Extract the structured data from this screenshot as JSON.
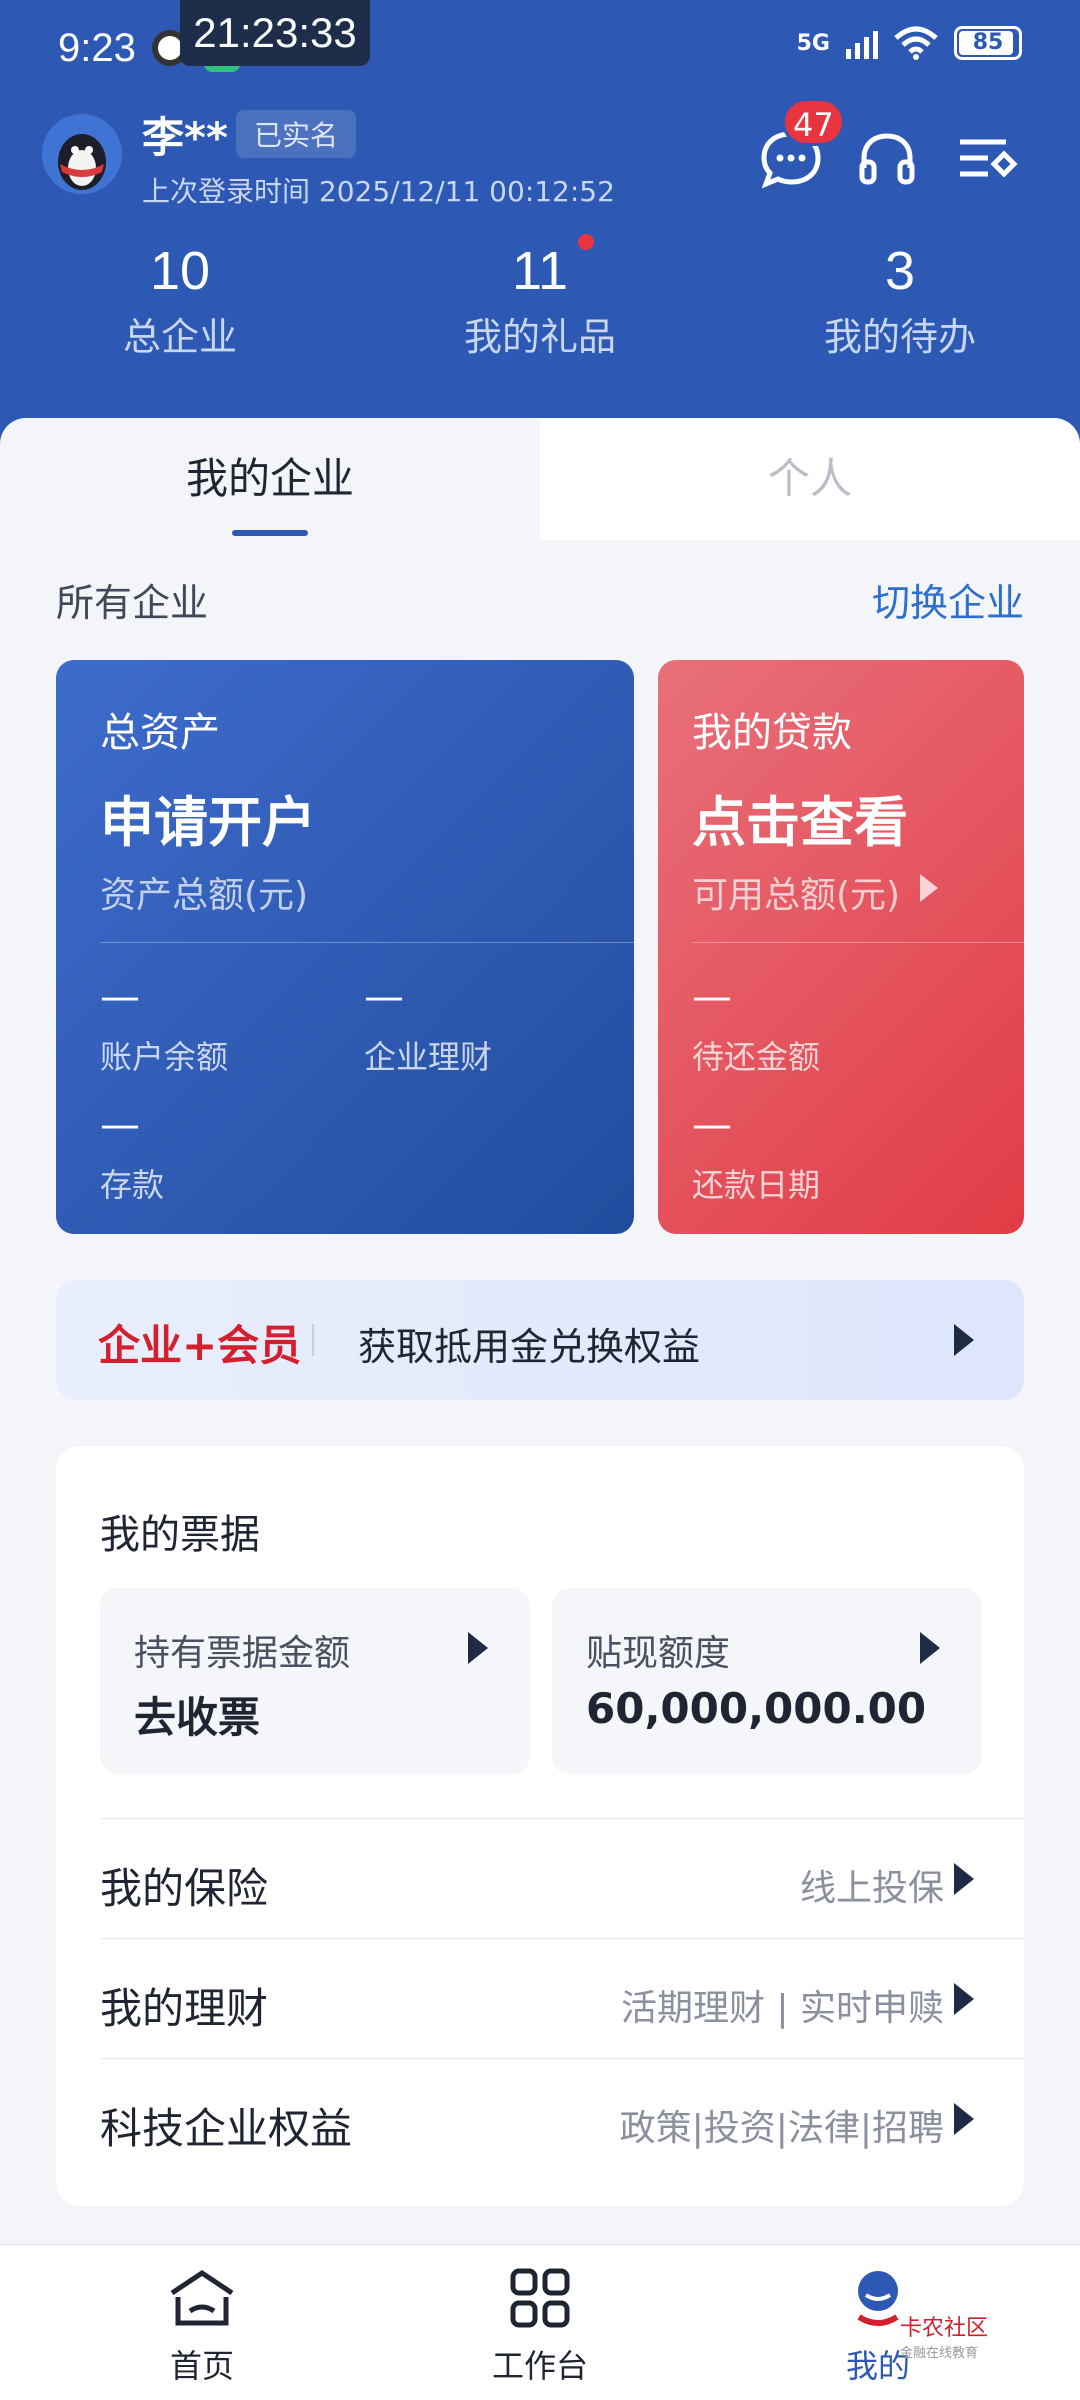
{
  "status_bar": {
    "time": "9:23",
    "floating_clock": "21:23:33",
    "network": "5G",
    "battery": "85"
  },
  "user": {
    "name": "李**",
    "verified_label": "已实名",
    "last_login": "上次登录时间 2025/12/11 00:12:52"
  },
  "header_icons": [
    "message-icon",
    "headset-icon",
    "menu-settings-icon"
  ],
  "message_badge": "47",
  "stats": [
    {
      "value": "10",
      "label": "总企业"
    },
    {
      "value": "11",
      "label": "我的礼品"
    },
    {
      "value": "3",
      "label": "我的待办"
    }
  ],
  "tabs": [
    {
      "label": "我的企业",
      "active": true
    },
    {
      "label": "个人",
      "active": false
    }
  ],
  "enterprise": {
    "section_title": "所有企业",
    "switch_label": "切换企业"
  },
  "asset_card": {
    "label": "总资产",
    "action": "申请开户",
    "sub": "资产总额(元)",
    "items": [
      {
        "value": "—",
        "label": "账户余额"
      },
      {
        "value": "—",
        "label": "企业理财"
      },
      {
        "value": "—",
        "label": "存款"
      }
    ]
  },
  "loan_card": {
    "label": "我的贷款",
    "action": "点击查看",
    "sub": "可用总额(元)",
    "items": [
      {
        "value": "—",
        "label": "待还金额"
      },
      {
        "value": "—",
        "label": "还款日期"
      }
    ]
  },
  "banner": {
    "brand": "企业+会员",
    "text": "获取抵用金兑换权益"
  },
  "bills": {
    "title": "我的票据",
    "held_label": "持有票据金额",
    "held_value": "去收票",
    "discount_label": "贴现额度",
    "discount_value": "60,000,000.00"
  },
  "rows": [
    {
      "label": "我的保险",
      "value": "线上投保"
    },
    {
      "label": "我的理财",
      "value": "活期理财 | 实时申赎"
    },
    {
      "label": "科技企业权益",
      "value": "政策|投资|法律|招聘"
    }
  ],
  "bottom_nav": [
    {
      "label": "首页",
      "icon": "home-icon"
    },
    {
      "label": "工作台",
      "icon": "grid-icon"
    },
    {
      "label": "我的",
      "icon": "profile-icon",
      "active": true
    }
  ],
  "watermark": {
    "title": "卡农社区",
    "subtitle": "金融在线教育"
  },
  "colors": {
    "primary": "#2d59b4",
    "accent_red": "#e13c46",
    "link": "#2d6fcf"
  }
}
